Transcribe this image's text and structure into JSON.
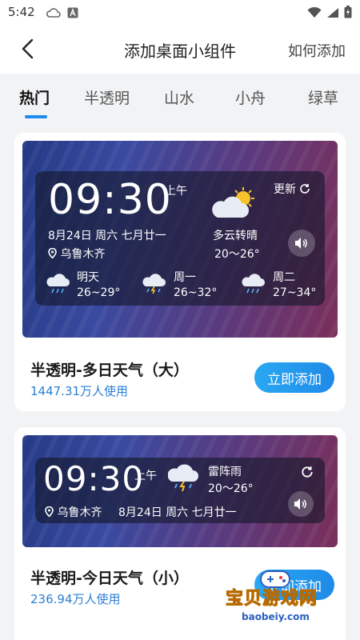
{
  "status": {
    "time": "5:42",
    "left_icons": [
      "cloud-icon",
      "a-icon"
    ],
    "right_icons": [
      "wifi-icon",
      "signal-icon",
      "battery-icon"
    ]
  },
  "nav": {
    "title": "添加桌面小组件",
    "action": "如何添加"
  },
  "tabs": [
    {
      "label": "热门",
      "active": true
    },
    {
      "label": "半透明"
    },
    {
      "label": "山水"
    },
    {
      "label": "小舟"
    },
    {
      "label": "绿草"
    }
  ],
  "cards": [
    {
      "time": "09:30",
      "ampm": "上午",
      "date": "8月24日 周六 七月廿一",
      "location": "乌鲁木齐",
      "refresh": "更新",
      "weather": "多云转晴",
      "temp": "20～26°",
      "forecast": [
        {
          "day": "明天",
          "temp": "26~29°",
          "icon": "rain-cloud-icon"
        },
        {
          "day": "周一",
          "temp": "26~32°",
          "icon": "thunder-cloud-icon"
        },
        {
          "day": "周二",
          "temp": "27~34°",
          "icon": "rain-cloud-icon"
        }
      ],
      "title": "半透明-多日天气（大）",
      "usage": "1447.31万人使用",
      "button": "立即添加"
    },
    {
      "time": "09:30",
      "ampm": "上午",
      "weather": "雷阵雨",
      "temp": "20～26°",
      "location": "乌鲁木齐",
      "date": "8月24日 周六 七月廿一",
      "title": "半透明-今日天气（小）",
      "usage": "236.94万人使用",
      "button": "立即添加"
    }
  ],
  "watermark": {
    "text": "宝贝游戏网",
    "url": "baobeiy.com"
  },
  "colors": {
    "accent": "#1e8cf0",
    "usage_text": "#2a7fd4",
    "button_start": "#2aa8f2",
    "button_end": "#1f8ae8"
  }
}
